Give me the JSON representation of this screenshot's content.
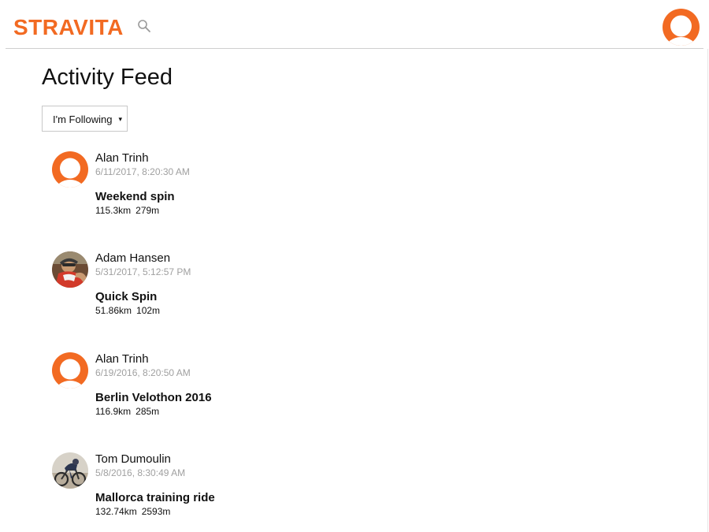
{
  "header": {
    "logo_text": "STRAVITA",
    "icons": {
      "search": "search-icon",
      "profile": "user-avatar-icon"
    },
    "brand_color": "#f26a22"
  },
  "page": {
    "title": "Activity Feed",
    "filter": {
      "selected": "I'm Following",
      "indicator": "▾"
    }
  },
  "feed": {
    "items": [
      {
        "athlete": "Alan Trinh",
        "avatar": "default-avatar",
        "time": "6/11/2017, 8:20:30 AM",
        "title": "Weekend spin",
        "distance": "115.3km",
        "elevation": "279m"
      },
      {
        "athlete": "Adam Hansen",
        "avatar": "photo-avatar-cyclist-portrait",
        "time": "5/31/2017, 5:12:57 PM",
        "title": "Quick Spin",
        "distance": "51.86km",
        "elevation": "102m"
      },
      {
        "athlete": "Alan Trinh",
        "avatar": "default-avatar",
        "time": "6/19/2016, 8:20:50 AM",
        "title": "Berlin Velothon 2016",
        "distance": "116.9km",
        "elevation": "285m"
      },
      {
        "athlete": "Tom Dumoulin",
        "avatar": "photo-avatar-cyclist-riding",
        "time": "5/8/2016, 8:30:49 AM",
        "title": "Mallorca training ride",
        "distance": "132.74km",
        "elevation": "2593m"
      }
    ]
  }
}
